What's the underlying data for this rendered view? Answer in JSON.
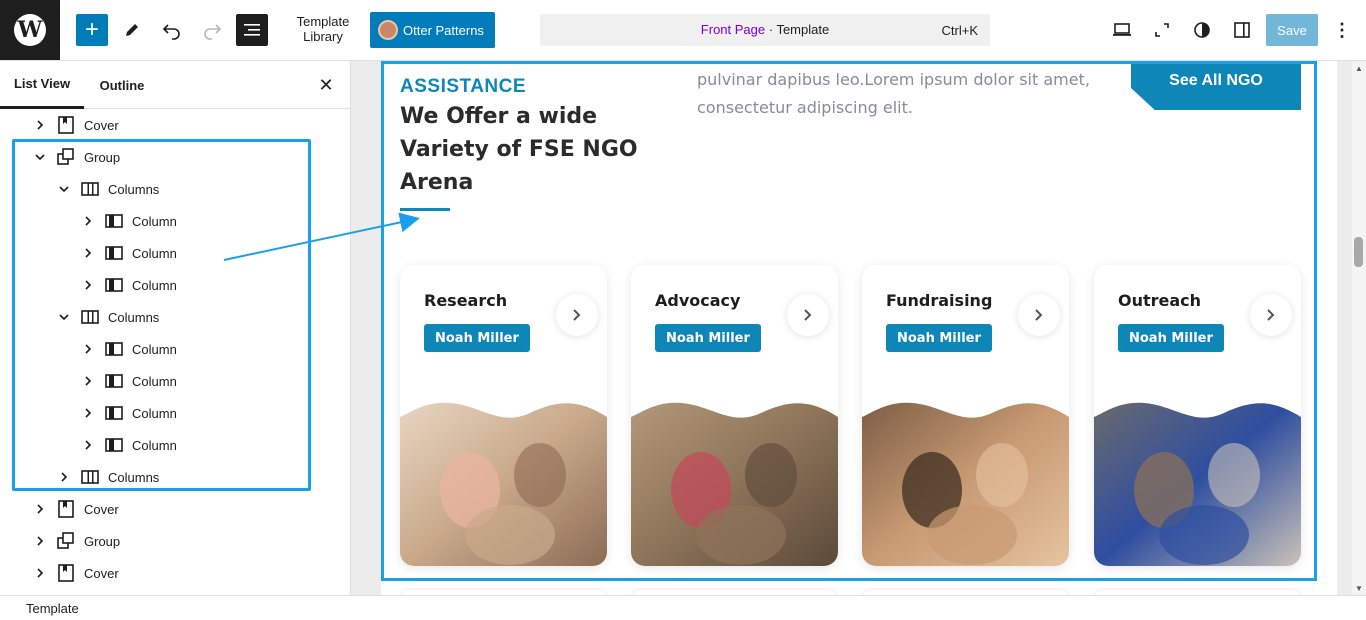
{
  "topbar": {
    "logo_icon": "wordpress-logo-icon",
    "add_icon": "plus-icon",
    "edit_icon": "pencil-icon",
    "undo_icon": "undo-icon",
    "redo_icon": "redo-icon",
    "document_overview_icon": "list-view-icon",
    "template_library_label": "Template Library",
    "otter_label": "Otter Patterns",
    "command": {
      "page": "Front Page",
      "separator": " · ",
      "type": "Template",
      "shortcut": "Ctrl+K"
    },
    "desktop_icon": "desktop-view-icon",
    "fullscreen_icon": "fullscreen-icon",
    "styles_icon": "half-circle-icon",
    "settings_icon": "sidebar-toggle-icon",
    "save_label": "Save",
    "options_label": "⋮"
  },
  "sidebar": {
    "tabs": [
      {
        "label": "List View",
        "active": true
      },
      {
        "label": "Outline",
        "active": false
      }
    ],
    "close_label": "✕",
    "tree": [
      {
        "label": "Cover",
        "icon": "cover-block-icon",
        "expanded": false,
        "level": 1
      },
      {
        "label": "Group",
        "icon": "group-block-icon",
        "expanded": true,
        "level": 1
      },
      {
        "label": "Columns",
        "icon": "columns-block-icon",
        "expanded": true,
        "level": 2
      },
      {
        "label": "Column",
        "icon": "column-block-icon",
        "expanded": false,
        "level": 3
      },
      {
        "label": "Column",
        "icon": "column-block-icon",
        "expanded": false,
        "level": 3
      },
      {
        "label": "Column",
        "icon": "column-block-icon",
        "expanded": false,
        "level": 3
      },
      {
        "label": "Columns",
        "icon": "columns-block-icon",
        "expanded": true,
        "level": 2
      },
      {
        "label": "Column",
        "icon": "column-block-icon",
        "expanded": false,
        "level": 3
      },
      {
        "label": "Column",
        "icon": "column-block-icon",
        "expanded": false,
        "level": 3
      },
      {
        "label": "Column",
        "icon": "column-block-icon",
        "expanded": false,
        "level": 3
      },
      {
        "label": "Column",
        "icon": "column-block-icon",
        "expanded": false,
        "level": 3
      },
      {
        "label": "Columns",
        "icon": "columns-block-icon",
        "expanded": false,
        "level": 2
      },
      {
        "label": "Cover",
        "icon": "cover-block-icon",
        "expanded": false,
        "level": 1
      },
      {
        "label": "Group",
        "icon": "group-block-icon",
        "expanded": false,
        "level": 1
      },
      {
        "label": "Cover",
        "icon": "cover-block-icon",
        "expanded": false,
        "level": 1
      }
    ]
  },
  "canvas": {
    "eyebrow": "ASSISTANCE",
    "heading": "We Offer a wide Variety of FSE NGO Arena",
    "intro": "pulvinar dapibus leo.Lorem ipsum dolor sit amet, consectetur adipiscing elit.",
    "cta_label": "See All NGO",
    "cards": [
      {
        "title": "Research",
        "badge": "Noah Miller",
        "image": "folded-sweaters-photo"
      },
      {
        "title": "Advocacy",
        "badge": "Noah Miller",
        "image": "children-by-wall-photo"
      },
      {
        "title": "Fundraising",
        "badge": "Noah Miller",
        "image": "smiling-children-photo"
      },
      {
        "title": "Outreach",
        "badge": "Noah Miller",
        "image": "volunteer-with-kids-photo"
      }
    ]
  },
  "footer": {
    "breadcrumb": "Template"
  },
  "colors": {
    "accent": "#007cba",
    "brand": "#0e86b8",
    "selection": "#1aa0e8",
    "command_page": "#7a00df"
  }
}
